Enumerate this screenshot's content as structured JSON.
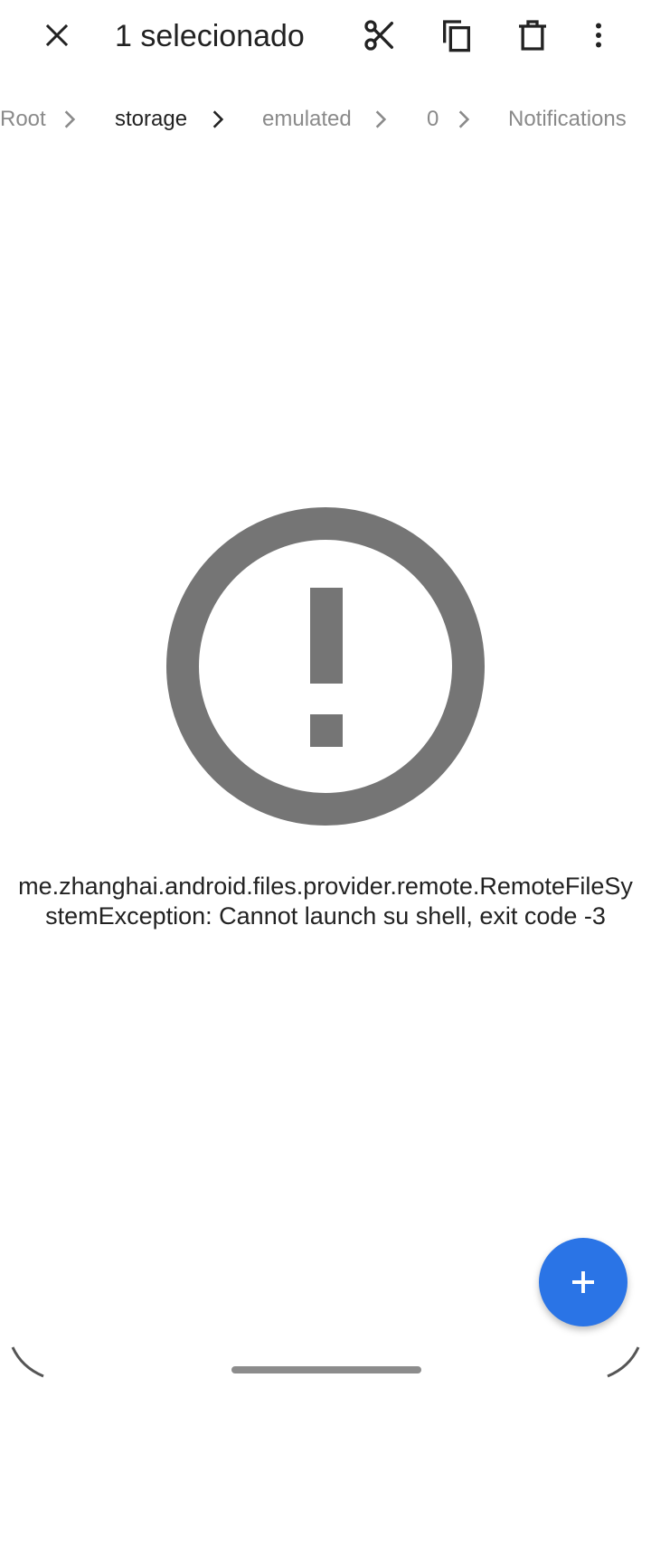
{
  "action_bar": {
    "title": "1 selecionado",
    "icons": {
      "close": "close-icon",
      "cut": "scissors-icon",
      "copy": "copy-icon",
      "delete": "trash-icon",
      "more": "more-vertical-icon"
    }
  },
  "breadcrumb": {
    "items": [
      {
        "label": "Root"
      },
      {
        "label": "storage"
      },
      {
        "label": "emulated"
      },
      {
        "label": "0"
      },
      {
        "label": "Notifications"
      }
    ]
  },
  "error": {
    "icon": "error-outline-icon",
    "message": "me.zhanghai.android.files.provider.remote.RemoteFileSystemException: Cannot launch su shell, exit code -3"
  },
  "fab": {
    "icon": "plus-icon"
  },
  "colors": {
    "accent": "#2a74e6",
    "icon_gray": "#757575",
    "text_primary": "#222222",
    "text_secondary": "#8a8a8a"
  }
}
